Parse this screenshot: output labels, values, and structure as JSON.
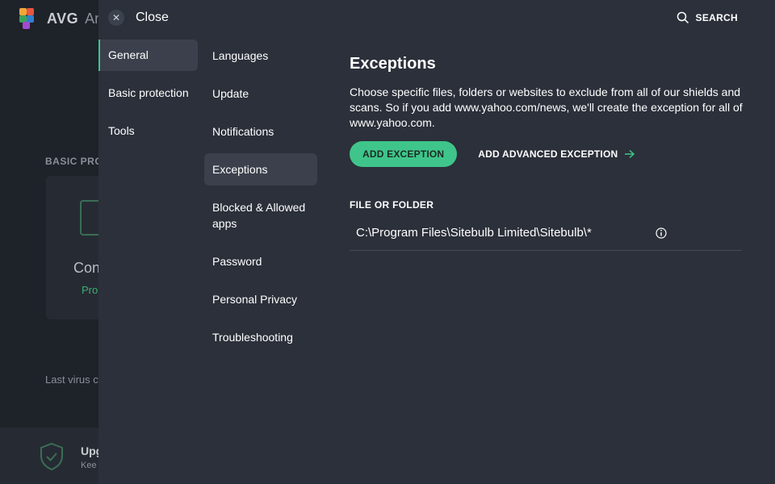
{
  "background": {
    "brand": "AVG",
    "product_partial": "An",
    "section_partial": "BASIC PRO",
    "card_title_partial": "Con",
    "card_status_partial": "Pro",
    "last_scan_partial": "Last virus c",
    "footer_title_partial": "Upg",
    "footer_sub_partial": "Kee"
  },
  "topbar": {
    "close_label": "Close",
    "search_label": "SEARCH"
  },
  "categories": [
    {
      "label": "General",
      "active": true
    },
    {
      "label": "Basic protection",
      "active": false
    },
    {
      "label": "Tools",
      "active": false
    }
  ],
  "subcategories": [
    {
      "label": "Languages",
      "active": false
    },
    {
      "label": "Update",
      "active": false
    },
    {
      "label": "Notifications",
      "active": false
    },
    {
      "label": "Exceptions",
      "active": true
    },
    {
      "label": "Blocked & Allowed apps",
      "active": false
    },
    {
      "label": "Password",
      "active": false
    },
    {
      "label": "Personal Privacy",
      "active": false
    },
    {
      "label": "Troubleshooting",
      "active": false
    }
  ],
  "content": {
    "title": "Exceptions",
    "description": "Choose specific files, folders or websites to exclude from all of our shields and scans. So if you add www.yahoo.com/news, we'll create the exception for all of www.yahoo.com.",
    "add_button": "ADD EXCEPTION",
    "advanced_link": "ADD ADVANCED EXCEPTION",
    "column_header": "FILE OR FOLDER",
    "exceptions": [
      {
        "path": "C:\\Program Files\\Sitebulb Limited\\Sitebulb\\*"
      }
    ]
  },
  "colors": {
    "accent": "#3fc58b",
    "panel": "#2b303a",
    "active_item": "#3b404c"
  },
  "icons": [
    "close-icon",
    "search-icon",
    "arrow-right-icon",
    "info-icon",
    "shield-check-icon"
  ]
}
